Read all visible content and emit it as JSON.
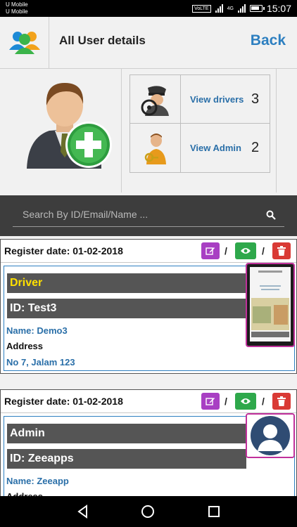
{
  "status_bar": {
    "carrier_1": "U Mobile",
    "carrier_2": "U Mobile",
    "volte": "VoLTE",
    "network": "4G",
    "time": "15:07"
  },
  "header": {
    "title": "All User details",
    "back_label": "Back"
  },
  "stats": {
    "drivers": {
      "label": "View drivers",
      "count": "3"
    },
    "admins": {
      "label": "View Admin",
      "count": "2"
    }
  },
  "search": {
    "placeholder": "Search By ID/Email/Name ..."
  },
  "cards": [
    {
      "register_date": "Register date: 01-02-2018",
      "role": "Driver",
      "id": "ID: Test3",
      "name": "Name: Demo3",
      "address_label": "Address",
      "address": "No 7, Jalam 123"
    },
    {
      "register_date": "Register date: 01-02-2018",
      "role": "Admin",
      "id": "ID: Zeeapps",
      "name": "Name: Zeeapp",
      "address_label": "Address"
    }
  ],
  "separators": {
    "slash": "/"
  },
  "colors": {
    "accent_blue": "#2d7fc0",
    "edit": "#a83fc3",
    "view": "#2ea84b",
    "delete": "#d93a35",
    "role_driver": "#ffe000"
  }
}
